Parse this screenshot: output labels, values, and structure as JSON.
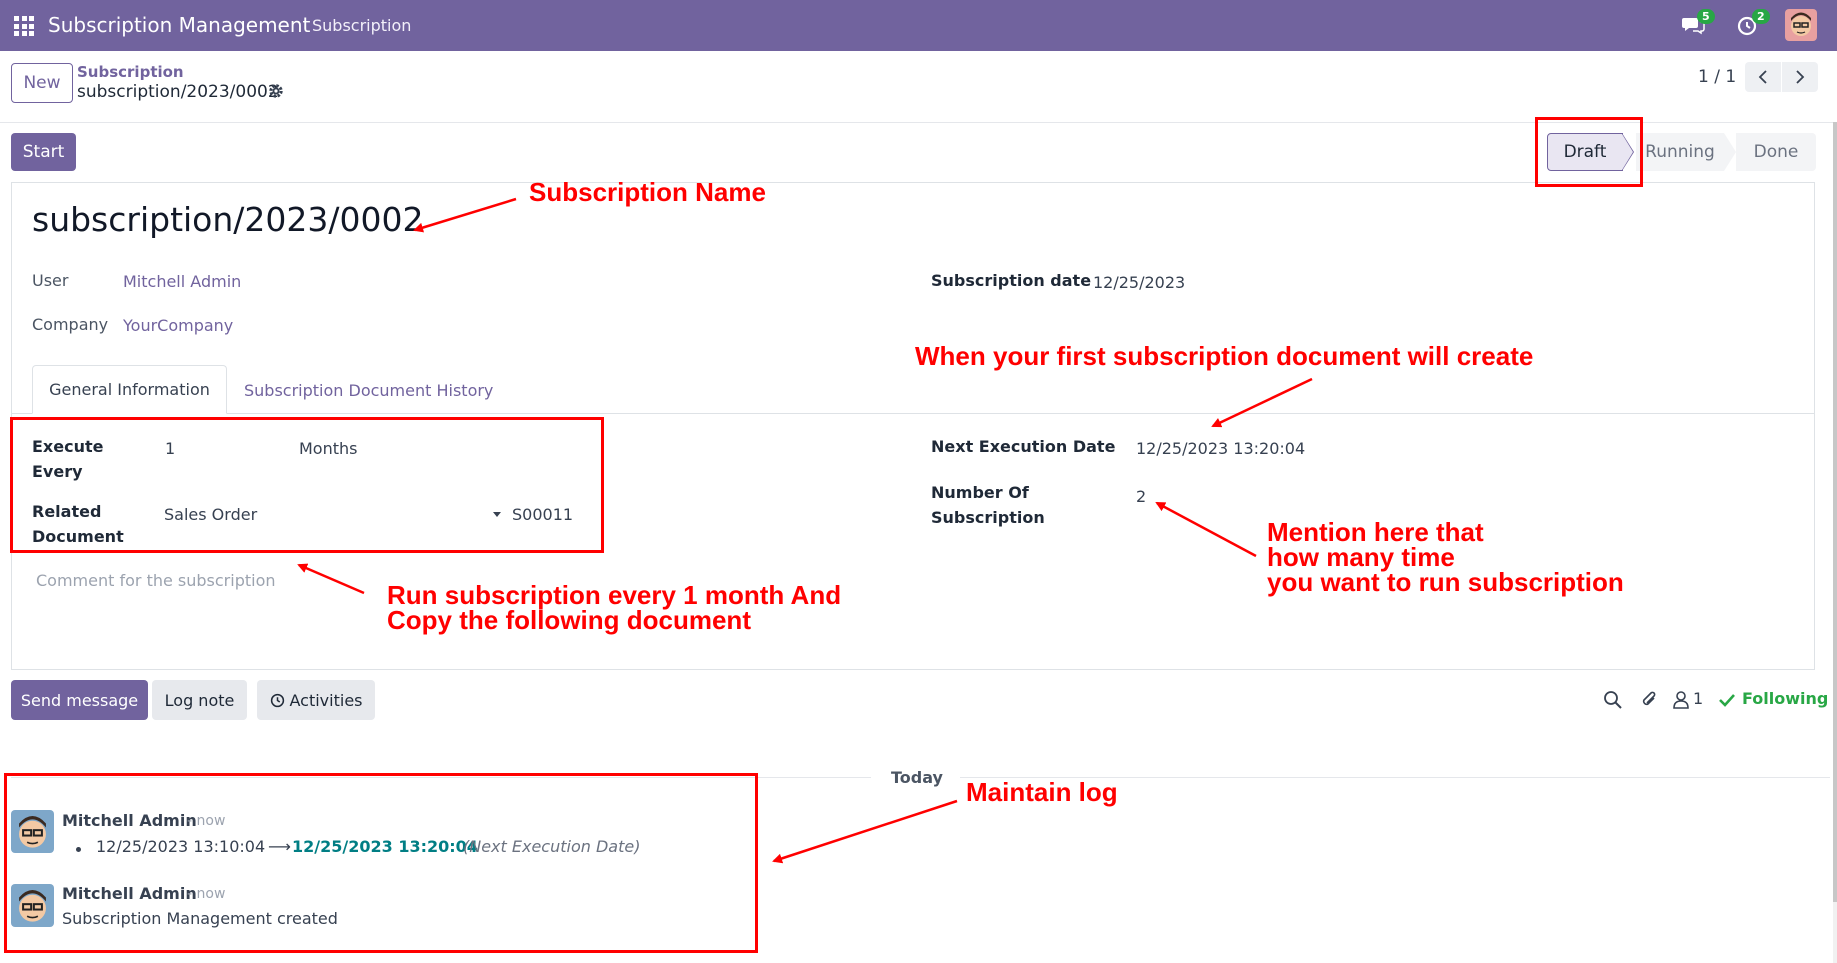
{
  "navbar": {
    "app_title": "Subscription Management",
    "menu_item": "Subscription",
    "chat_badge": "5",
    "activity_badge": "2"
  },
  "control_panel": {
    "new_button": "New",
    "breadcrumb_parent": "Subscription",
    "breadcrumb_current": "subscription/2023/0002",
    "pager_value": "1 / 1"
  },
  "statusbar": {
    "start_button": "Start",
    "stages": [
      "Draft",
      "Running",
      "Done"
    ],
    "active_stage": "Draft"
  },
  "form": {
    "title": "subscription/2023/0002",
    "user_label": "User",
    "user_value": "Mitchell Admin",
    "company_label": "Company",
    "company_value": "YourCompany",
    "subscription_date_label": "Subscription date",
    "subscription_date_value": "12/25/2023",
    "tabs": [
      "General Information",
      "Subscription Document History"
    ],
    "execute_every_label_1": "Execute",
    "execute_every_label_2": "Every",
    "execute_every_value": "1",
    "execute_every_unit": "Months",
    "related_document_label_1": "Related",
    "related_document_label_2": "Document",
    "related_document_model": "Sales Order",
    "related_document_ref": "S00011",
    "next_execution_label": "Next Execution Date",
    "next_execution_value": "12/25/2023 13:20:04",
    "number_of_sub_label_1": "Number Of",
    "number_of_sub_label_2": "Subscription",
    "number_of_sub_value": "2",
    "comment_placeholder": "Comment for the subscription"
  },
  "chatter": {
    "send_message": "Send message",
    "log_note": "Log note",
    "activities": "Activities",
    "followers_count": "1",
    "following": "Following",
    "today": "Today",
    "messages": [
      {
        "author": "Mitchell Admin",
        "time": "- now",
        "tracking_old": "12/25/2023 13:10:04",
        "tracking_new": "12/25/2023 13:20:04",
        "tracking_field": "(Next Execution Date)"
      },
      {
        "author": "Mitchell Admin",
        "time": "- now",
        "body": "Subscription Management created"
      }
    ]
  },
  "annotations": {
    "subscription_name": "Subscription Name",
    "first_doc": "When your first subscription document will create",
    "run_every_1": "Run subscription every 1 month And",
    "run_every_2": "Copy the following document",
    "mention_1": "Mention here that",
    "mention_2": "how many time",
    "mention_3": "you want to run subscription",
    "maintain_log": "Maintain log"
  },
  "colors": {
    "brand": "#71639e",
    "annotation": "#ff0000",
    "following": "#28a745",
    "tracking_new": "#017e84"
  }
}
